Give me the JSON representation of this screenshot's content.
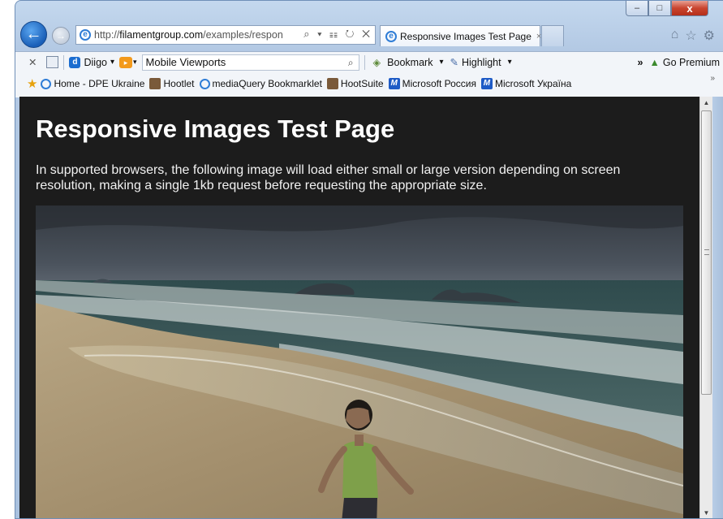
{
  "window": {
    "caption_buttons": {
      "minimize": "–",
      "maximize": "□",
      "close": "x"
    }
  },
  "nav": {
    "back_icon": "←",
    "forward_icon": "→",
    "address": {
      "prefix": "http://",
      "domain": "filamentgroup.com",
      "path": "/examples/respon"
    },
    "address_icons": "⌕ ▾ ☷ ↻ ✕",
    "tab": {
      "title": "Responsive Images Test Page",
      "close": "×"
    },
    "right_icons": {
      "home": "⌂",
      "favorites": "☆",
      "tools": "⚙"
    }
  },
  "toolbar": {
    "stop_icon": "✕",
    "diigo_label": "Diigo",
    "diigo_logo": "d",
    "dropdown": "▾",
    "search_value": "Mobile Viewports",
    "search_icon": "⌕",
    "bookmark_label": "Bookmark",
    "highlight_label": "Highlight",
    "more": "»",
    "premium_label": "Go Premium"
  },
  "favorites": {
    "items": [
      {
        "label": "Home - DPE Ukraine",
        "icon": "ie"
      },
      {
        "label": "Hootlet",
        "icon": "hoot"
      },
      {
        "label": "mediaQuery Bookmarklet",
        "icon": "ie"
      },
      {
        "label": "HootSuite",
        "icon": "hoot"
      },
      {
        "label": "Microsoft Россия",
        "icon": "ms"
      },
      {
        "label": "Microsoft Україна",
        "icon": "ms"
      }
    ],
    "ms_letter": "M",
    "more": "»"
  },
  "page": {
    "title": "Responsive Images Test Page",
    "description": "In supported browsers, the following image will load either small or large version depending on screen resolution, making a single 1kb request before requesting the appropriate size."
  },
  "scrollbar": {
    "up": "▲",
    "down": "▼"
  },
  "colors": {
    "content_bg": "#1c1c1c",
    "title_text": "#ffffff",
    "accent_blue": "#1a5fb8"
  }
}
